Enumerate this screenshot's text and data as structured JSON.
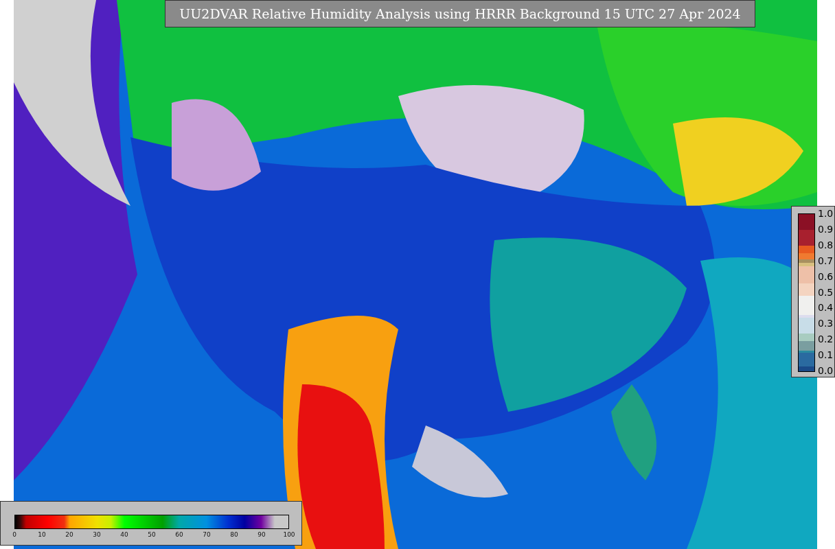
{
  "title": "UU2DVAR Relative Humidity Analysis using HRRR Background 15 UTC 27 Apr 2024",
  "humidity_colorbar": {
    "ticks": [
      "0",
      "10",
      "20",
      "30",
      "40",
      "50",
      "60",
      "70",
      "80",
      "90",
      "100"
    ]
  },
  "station_colorbar": {
    "ticks": [
      "1.0",
      "0.9",
      "0.8",
      "0.7",
      "0.6",
      "0.5",
      "0.4",
      "0.3",
      "0.2",
      "0.1",
      "0.0"
    ]
  }
}
